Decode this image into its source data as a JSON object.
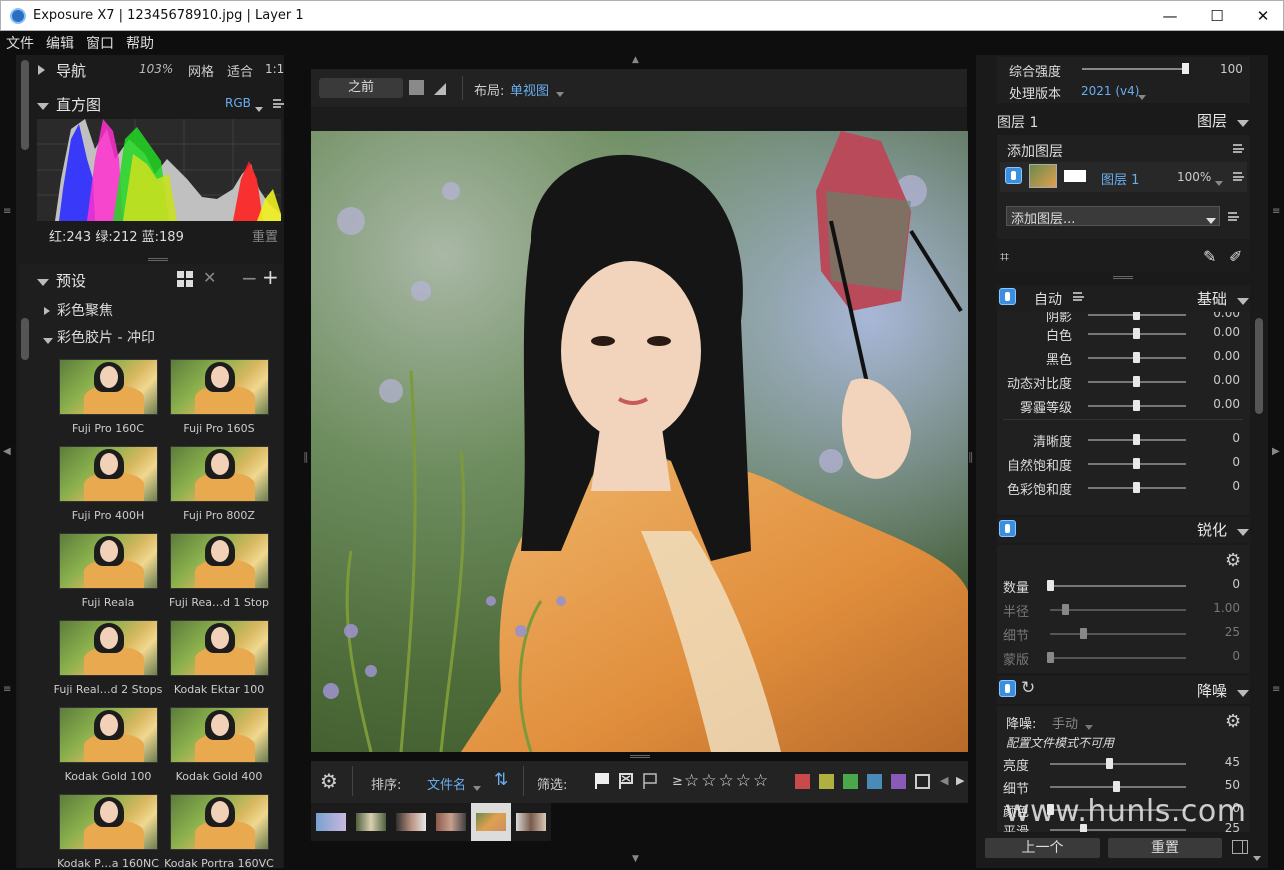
{
  "window": {
    "title": "Exposure X7 | 12345678910.jpg | Layer 1",
    "minimize": "—",
    "maximize": "☐",
    "close": "✕"
  },
  "menu": [
    "文件",
    "编辑",
    "窗口",
    "帮助"
  ],
  "left": {
    "nav": {
      "label": "导航",
      "zoom": "103%",
      "grid": "网格",
      "fit": "适合",
      "one": "1:1"
    },
    "histogram": {
      "label": "直方图",
      "mode": "RGB",
      "readout": "红:243 绿:212 蓝:189",
      "reset": "重置"
    },
    "presets": {
      "label": "预设",
      "groups": [
        "彩色聚焦",
        "彩色胶片 - 冲印"
      ],
      "items": [
        "Fuji Pro 160C",
        "Fuji Pro 160S",
        "Fuji Pro 400H",
        "Fuji Pro 800Z",
        "Fuji Reala",
        "Fuji Rea…d 1 Stop",
        "Fuji Real…d 2 Stops",
        "Kodak Ektar 100",
        "Kodak Gold 100",
        "Kodak Gold 400",
        "Kodak P…a 160NC",
        "Kodak Portra 160VC"
      ]
    }
  },
  "center": {
    "before": "之前",
    "layout_label": "布局:",
    "layout_value": "单视图",
    "sort_label": "排序:",
    "sort_value": "文件名",
    "filter_label": "筛选:",
    "rating_prefix": "≥",
    "stars": "☆☆☆☆☆",
    "colors": [
      "#c84a4a",
      "#b0b040",
      "#4aa84a",
      "#4a8ab8",
      "#8a5ab8"
    ]
  },
  "right": {
    "overall": {
      "label": "综合强度",
      "value": "100",
      "process_label": "处理版本",
      "process_value": "2021 (v4)"
    },
    "layers": {
      "current": "图层 1",
      "title": "图层",
      "add_layer": "添加图层",
      "layer_name": "图层 1",
      "opacity": "100%",
      "add_dropdown": "添加图层..."
    },
    "basic": {
      "auto": "自动",
      "title": "基础",
      "rows": [
        {
          "label": "阴影",
          "value": "0.00"
        },
        {
          "label": "白色",
          "value": "0.00"
        },
        {
          "label": "黑色",
          "value": "0.00"
        },
        {
          "label": "动态对比度",
          "value": "0.00"
        },
        {
          "label": "雾霾等级",
          "value": "0.00"
        },
        {
          "label": "清晰度",
          "value": "0"
        },
        {
          "label": "自然饱和度",
          "value": "0"
        },
        {
          "label": "色彩饱和度",
          "value": "0"
        }
      ]
    },
    "sharpen": {
      "title": "锐化",
      "rows": [
        {
          "label": "数量",
          "value": "0"
        },
        {
          "label": "半径",
          "value": "1.00"
        },
        {
          "label": "细节",
          "value": "25"
        },
        {
          "label": "蒙版",
          "value": "0"
        }
      ]
    },
    "noise": {
      "title": "降噪",
      "mode_label": "降噪:",
      "mode_value": "手动",
      "note": "配置文件模式不可用",
      "rows": [
        {
          "label": "亮度",
          "value": "45"
        },
        {
          "label": "细节",
          "value": "50"
        },
        {
          "label": "颜色",
          "value": "0"
        },
        {
          "label": "平滑",
          "value": "25"
        }
      ]
    },
    "prev": "上一个",
    "reset": "重置"
  },
  "watermark": "www.hunls.com"
}
